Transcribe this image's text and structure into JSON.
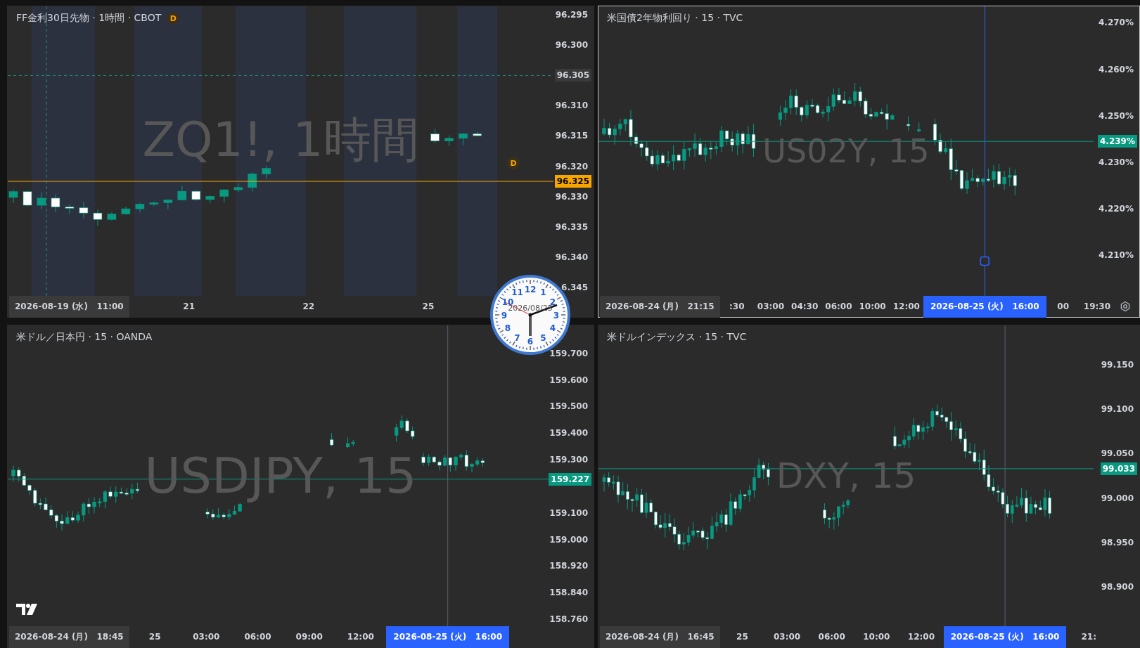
{
  "panels": [
    {
      "title": "FF金利30日先物 · 1時間 · CBOT",
      "title_badge": "D",
      "plot_badge": "D",
      "selected": false,
      "watermark": "ZQ1!, 1時間",
      "price_axis": [
        {
          "text": "96.295",
          "kind": "tick"
        },
        {
          "text": "96.300",
          "kind": "tick"
        },
        {
          "text": "96.305",
          "kind": "marker"
        },
        {
          "text": "96.310",
          "kind": "tick"
        },
        {
          "text": "96.315",
          "kind": "tick"
        },
        {
          "text": "96.320",
          "kind": "tick"
        },
        {
          "text": "96.330",
          "kind": "tick"
        },
        {
          "text": "96.335",
          "kind": "tick"
        },
        {
          "text": "96.340",
          "kind": "tick"
        },
        {
          "text": "6.345",
          "kind": "tick"
        }
      ],
      "last_price": {
        "text": "96.325",
        "color": "#f7a600"
      },
      "time_axis": [
        {
          "kind": "date",
          "text": "2026-08-19 (水)   11:00"
        },
        {
          "kind": "tick",
          "text": "21"
        },
        {
          "kind": "tick",
          "text": "22"
        },
        {
          "kind": "tick",
          "text": "25"
        }
      ]
    },
    {
      "title": "米国債2年物利回り · 15 · TVC",
      "selected": true,
      "watermark": "US02Y, 15",
      "price_axis": [
        {
          "text": "4.270%",
          "kind": "tick"
        },
        {
          "text": "4.260%",
          "kind": "tick"
        },
        {
          "text": "4.250%",
          "kind": "tick"
        },
        {
          "text": "4.230%",
          "kind": "tick"
        },
        {
          "text": "4.220%",
          "kind": "tick"
        },
        {
          "text": "4.210%",
          "kind": "tick"
        }
      ],
      "last_price": {
        "text": "4.239%",
        "color": "#089981"
      },
      "time_axis": [
        {
          "kind": "date",
          "text": "2026-08-24 (月)   21:15"
        },
        {
          "kind": "tick",
          "text": ":30"
        },
        {
          "kind": "tick",
          "text": "03:00"
        },
        {
          "kind": "tick",
          "text": "04:30"
        },
        {
          "kind": "tick",
          "text": "06:00"
        },
        {
          "kind": "tick",
          "text": "10:00"
        },
        {
          "kind": "tick",
          "text": "12:00"
        },
        {
          "kind": "cursor",
          "text": "2026-08-25 (火)   16:00"
        },
        {
          "kind": "tick",
          "text": "00"
        },
        {
          "kind": "tick",
          "text": "19:30"
        },
        {
          "kind": "settings"
        }
      ]
    },
    {
      "title": "米ドル／日本円 · 15 · OANDA",
      "selected": false,
      "watermark": "USDJPY, 15",
      "price_axis": [
        {
          "text": "159.700",
          "kind": "tick"
        },
        {
          "text": "159.600",
          "kind": "tick"
        },
        {
          "text": "159.500",
          "kind": "tick"
        },
        {
          "text": "159.400",
          "kind": "tick"
        },
        {
          "text": "159.300",
          "kind": "tick"
        },
        {
          "kind": "gap"
        },
        {
          "text": "159.100",
          "kind": "tick"
        },
        {
          "text": "159.000",
          "kind": "tick"
        },
        {
          "text": "158.920",
          "kind": "tick"
        },
        {
          "text": "158.840",
          "kind": "tick"
        },
        {
          "text": "158.760",
          "kind": "tick"
        }
      ],
      "last_price": {
        "text": "159.227",
        "color": "#089981"
      },
      "time_axis": [
        {
          "kind": "date",
          "text": "2026-08-24 (月)   18:45"
        },
        {
          "kind": "tick",
          "text": "25"
        },
        {
          "kind": "tick",
          "text": "03:00"
        },
        {
          "kind": "tick",
          "text": "06:00"
        },
        {
          "kind": "tick",
          "text": "09:00"
        },
        {
          "kind": "tick",
          "text": "12:00"
        },
        {
          "kind": "cursor",
          "text": "2026-08-25 (火)   16:00"
        }
      ]
    },
    {
      "title": "米ドルインデックス · 15 · TVC",
      "selected": false,
      "watermark": "DXY, 15",
      "price_axis": [
        {
          "text": "99.150",
          "kind": "tick"
        },
        {
          "text": "99.100",
          "kind": "tick"
        },
        {
          "text": "99.050",
          "kind": "tick"
        },
        {
          "text": "99.000",
          "kind": "tick"
        },
        {
          "text": "98.950",
          "kind": "tick"
        },
        {
          "text": "98.900",
          "kind": "tick"
        }
      ],
      "last_price": {
        "text": "99.033",
        "color": "#089981"
      },
      "time_axis": [
        {
          "kind": "date",
          "text": "2026-08-24 (月)   16:45"
        },
        {
          "kind": "tick",
          "text": "25"
        },
        {
          "kind": "tick",
          "text": "03:00"
        },
        {
          "kind": "tick",
          "text": "06:00"
        },
        {
          "kind": "tick",
          "text": "10:00"
        },
        {
          "kind": "tick",
          "text": "12:00"
        },
        {
          "kind": "cursor",
          "text": "2026-08-25 (火)   16:00"
        },
        {
          "kind": "tick",
          "text": "21:"
        }
      ]
    }
  ],
  "clock": {
    "numbers": [
      "12",
      "11",
      "1",
      "10",
      "2",
      "9",
      "3",
      "8",
      "4",
      "7",
      "5",
      "6"
    ],
    "date": "2026/08/25"
  }
}
